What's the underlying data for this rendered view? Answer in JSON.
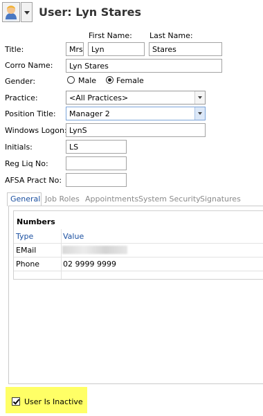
{
  "header": {
    "title": "User: Lyn Stares",
    "avatar_icon": "user-avatar-icon"
  },
  "form": {
    "first_name_header": "First Name:",
    "last_name_header": "Last Name:",
    "title_label": "Title:",
    "title_value": "Mrs",
    "first_name_value": "Lyn",
    "last_name_value": "Stares",
    "corro_label": "Corro Name:",
    "corro_value": "Lyn  Stares",
    "gender_label": "Gender:",
    "gender_male": "Male",
    "gender_female": "Female",
    "gender_selected": "Female",
    "practice_label": "Practice:",
    "practice_value": "<All Practices>",
    "position_label": "Position Title:",
    "position_value": "Manager 2",
    "windows_label": "Windows Logon:",
    "windows_value": "LynS",
    "initials_label": "Initials:",
    "initials_value": "LS",
    "regliq_label": "Reg Liq No:",
    "regliq_value": "",
    "afsa_label": "AFSA Pract No:",
    "afsa_value": ""
  },
  "tabs": [
    {
      "label": "General",
      "active": true
    },
    {
      "label": "Job Roles",
      "active": false
    },
    {
      "label": "Appointments",
      "active": false
    },
    {
      "label": "System Security",
      "active": false
    },
    {
      "label": "Signatures",
      "active": false
    }
  ],
  "numbers": {
    "title": "Numbers",
    "col_type": "Type",
    "col_value": "Value",
    "rows": [
      {
        "type": "EMail",
        "value": ""
      },
      {
        "type": "Phone",
        "value": "02 9999 9999"
      }
    ]
  },
  "inactive": {
    "label": "User Is Inactive",
    "checked": true,
    "highlight_color": "#ffff66"
  },
  "colors": {
    "accent": "#1a4fa0",
    "highlight": "#ffff66"
  }
}
